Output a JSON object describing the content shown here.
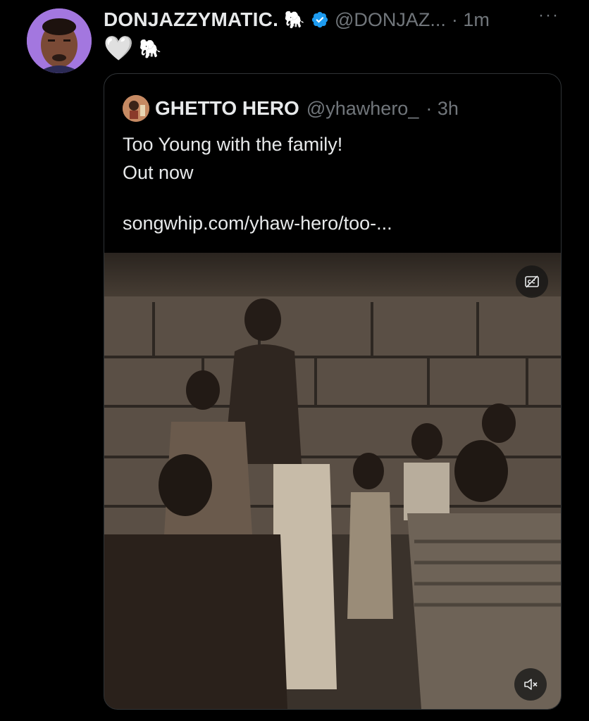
{
  "tweet": {
    "display_name": "DONJAZZYMATIC.",
    "name_emoji": "🐘",
    "handle": "@DONJAZ...",
    "time": "· 1m",
    "more": "···",
    "text_heart": "🤍",
    "text_emoji": "🐘"
  },
  "quote": {
    "name": "GHETTO HERO",
    "handle": "@yhawhero_",
    "time": "· 3h",
    "lines": [
      "Too Young with the family!",
      "Out now"
    ],
    "link": "songwhip.com/yhaw-hero/too-..."
  },
  "media": {
    "icons": {
      "captions": "closed-captions-off-icon",
      "sound": "sound-muted-icon"
    }
  },
  "colors": {
    "background": "#000000",
    "text": "#e7e9ea",
    "secondary": "#71767b",
    "verified": "#1d9bf0",
    "border": "#2f3336"
  }
}
